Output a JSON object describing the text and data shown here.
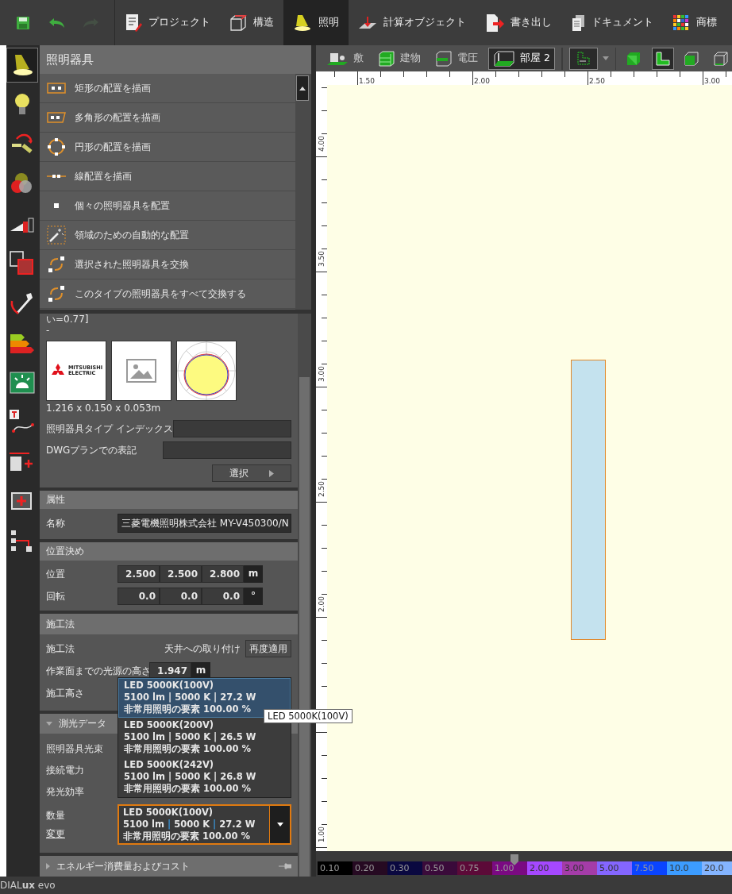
{
  "quick_actions": [
    {
      "kind": "save",
      "disabled": false
    },
    {
      "kind": "undo",
      "disabled": false
    },
    {
      "kind": "redo",
      "disabled": true
    }
  ],
  "main_tabs": [
    {
      "label": "プロジェクト",
      "kind": "project",
      "selected": false
    },
    {
      "label": "構造",
      "kind": "structure",
      "selected": false
    },
    {
      "label": "照明",
      "kind": "light",
      "selected": true
    },
    {
      "label": "計算オブジェクト",
      "kind": "calc",
      "selected": false
    },
    {
      "label": "書き出し",
      "kind": "export",
      "selected": false
    },
    {
      "label": "ドキュメント",
      "kind": "documents",
      "selected": false
    },
    {
      "label": "商標",
      "kind": "brand",
      "selected": false
    }
  ],
  "tool_sidebar": [
    {
      "kind": "luminaire",
      "selected": true
    },
    {
      "kind": "bulb",
      "selected": false
    },
    {
      "kind": "arm",
      "selected": false
    },
    {
      "kind": "colors",
      "selected": false
    },
    {
      "kind": "wedge",
      "selected": false
    },
    {
      "kind": "squares",
      "selected": false
    },
    {
      "kind": "wrench",
      "selected": false
    },
    {
      "kind": "energy",
      "selected": false
    },
    {
      "kind": "alarm",
      "selected": false
    },
    {
      "kind": "curve",
      "selected": false
    },
    {
      "kind": "plusrect",
      "selected": false
    },
    {
      "kind": "frameplus",
      "selected": false
    },
    {
      "kind": "tree",
      "selected": false
    }
  ],
  "panel": {
    "title": "照明器具",
    "actions": [
      {
        "kind": "rect",
        "label": "矩形の配置を描画"
      },
      {
        "kind": "polygon",
        "label": "多角形の配置を描画"
      },
      {
        "kind": "circle",
        "label": "円形の配置を描画"
      },
      {
        "kind": "line",
        "label": "線配置を描画"
      },
      {
        "kind": "single",
        "label": "個々の照明器具を配置"
      },
      {
        "kind": "auto",
        "label": "領域のための自動的な配置"
      },
      {
        "kind": "swap",
        "label": "選択された照明器具を交換"
      },
      {
        "kind": "swap",
        "label": "このタイプの照明器具をすべて交換する"
      }
    ],
    "details": {
      "rating": "い=0.77]",
      "dash": "-",
      "thumbnails": [
        {
          "kind": "logo",
          "lines": [
            "MITSUBISHI",
            "ELECTRIC"
          ]
        },
        {
          "kind": "placeholder"
        },
        {
          "kind": "polar"
        }
      ],
      "dimensions": "1.216 x 0.150 x 0.053m",
      "fields": [
        {
          "label": "照明器具タイプ インデックス"
        },
        {
          "label": "DWGプランでの表記"
        }
      ],
      "select_button": "選択"
    },
    "attributes": {
      "title": "属性",
      "name_label": "名称",
      "name_value": "三菱電機照明株式会社 MY-V450300/N"
    },
    "positioning": {
      "title": "位置決め",
      "rows": [
        {
          "label": "位置",
          "values": [
            "2.500",
            "2.500",
            "2.800"
          ],
          "unit": "m"
        },
        {
          "label": "回転",
          "values": [
            "0.0",
            "0.0",
            "0.0"
          ],
          "unit": "°"
        }
      ]
    },
    "mounting": {
      "title": "施工法",
      "method_label": "施工法",
      "method_value": "天井への取り付け",
      "reapply_button": "再度適用",
      "height_label": "作業面までの光源の高さ",
      "height_value": "1.947",
      "height_unit": "m",
      "mount_height_label": "施工高さ"
    },
    "photometry": {
      "title": "測光データ",
      "expanded": true,
      "labels": [
        "照明器具光束",
        "接続電力",
        "発光効率"
      ],
      "quantity_label": "数量",
      "change_link": "変更",
      "selector": {
        "name": "LED 5000K(100V)",
        "values": [
          "5100 lm",
          "5000 K",
          "27.2 W"
        ],
        "separator": "|",
        "emergency": "非常用照明の要素 100.00 %"
      }
    },
    "energy": {
      "title": "エネルギー消費量およびコスト",
      "expanded": false
    }
  },
  "popup": {
    "options": [
      {
        "name": "LED 5000K(100V)",
        "values": [
          "5100 lm",
          "5000 K",
          "27.2 W"
        ],
        "separator": "|",
        "emergency": "非常用照明の要素 100.00 %",
        "selected": true
      },
      {
        "name": "LED 5000K(200V)",
        "values": [
          "5100 lm",
          "5000 K",
          "26.5 W"
        ],
        "separator": "|",
        "emergency": "非常用照明の要素 100.00 %",
        "selected": false
      },
      {
        "name": "LED 5000K(242V)",
        "values": [
          "5100 lm",
          "5000 K",
          "26.8 W"
        ],
        "separator": "|",
        "emergency": "非常用照明の要素 100.00 %",
        "selected": false
      }
    ],
    "tooltip": "LED 5000K(100V)"
  },
  "canvas": {
    "toolbar": [
      {
        "kind": "site",
        "label": "敷",
        "selected": false
      },
      {
        "kind": "building",
        "label": "建物",
        "selected": false
      },
      {
        "kind": "storey",
        "label": "電圧",
        "selected": false
      },
      {
        "kind": "room",
        "label": "部屋 2",
        "selected": true
      }
    ],
    "views": [
      {
        "kind": "solid",
        "selected": false
      },
      {
        "kind": "floor",
        "selected": true
      },
      {
        "kind": "box",
        "selected": false
      },
      {
        "kind": "wire",
        "selected": false
      }
    ],
    "x_labels": [
      "1.50",
      "2.00",
      "2.50",
      "3.00"
    ],
    "y_labels": [
      "4.00",
      "3.50",
      "3.00",
      "2.50",
      "2.00",
      "1.00"
    ]
  },
  "legend": [
    {
      "label": "0.10",
      "color": "#000000"
    },
    {
      "label": "0.20",
      "color": "#260a22"
    },
    {
      "label": "0.30",
      "color": "#0a0840"
    },
    {
      "label": "0.50",
      "color": "#3a0a3a"
    },
    {
      "label": "0.75",
      "color": "#5c0a38"
    },
    {
      "label": "1.00",
      "color": "#7a0a82"
    },
    {
      "label": "2.00",
      "color": "#a548ff"
    },
    {
      "label": "3.00",
      "color": "#a43ca8"
    },
    {
      "label": "5.00",
      "color": "#8466ff"
    },
    {
      "label": "7.50",
      "color": "#0a44ff"
    },
    {
      "label": "10.0",
      "color": "#3c9cff"
    },
    {
      "label": "20.0",
      "color": "#84b4ff"
    }
  ],
  "status_bar": {
    "logo": "DIAL**ux** evo"
  }
}
